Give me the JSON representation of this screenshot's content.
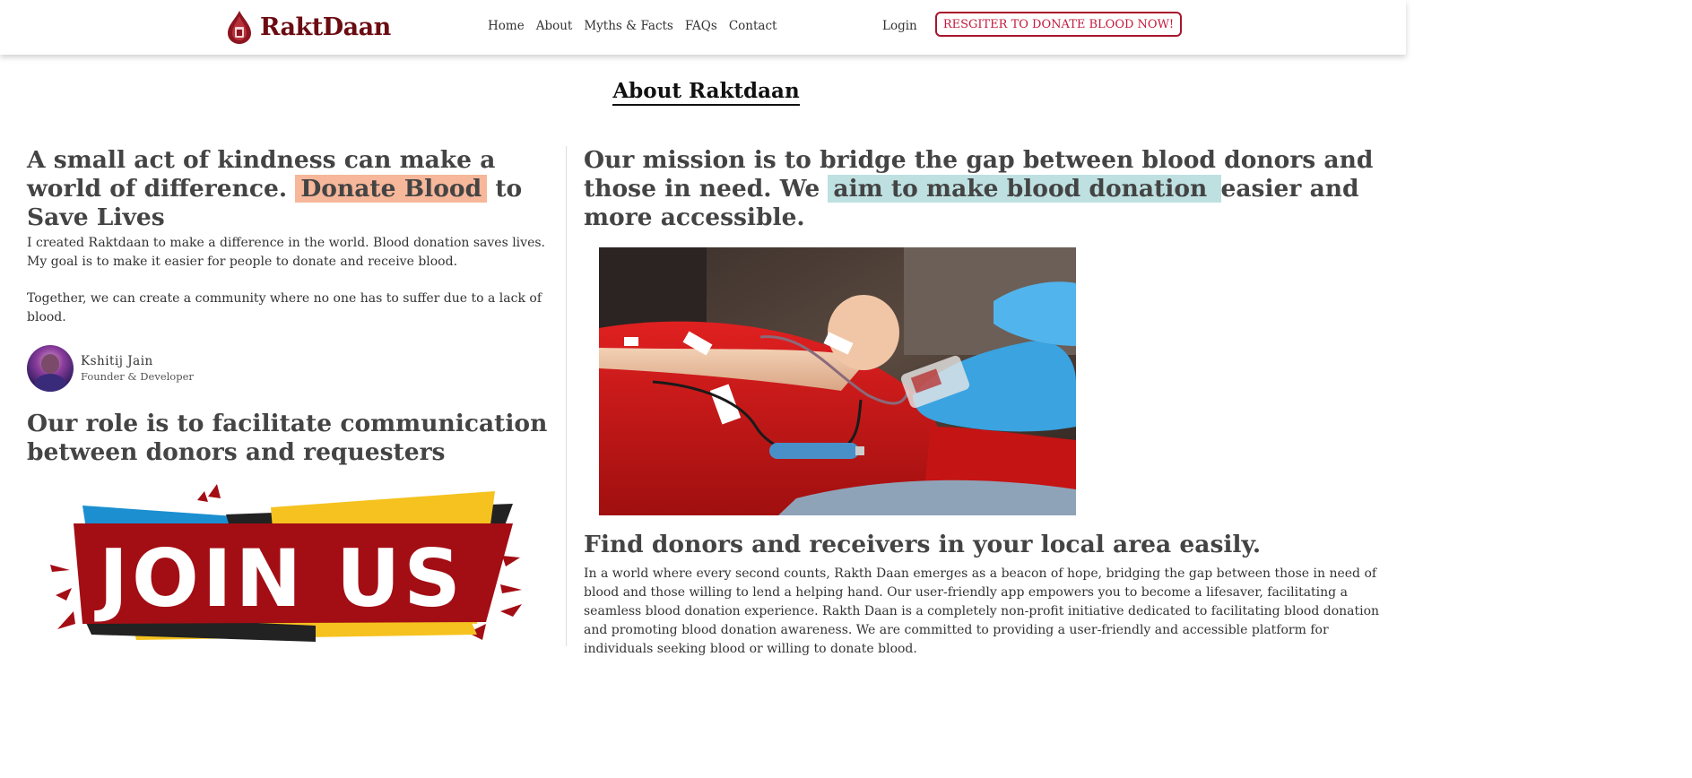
{
  "brand": {
    "name": "RaktDaan"
  },
  "nav": {
    "items": [
      "Home",
      "About",
      "Myths & Facts",
      "FAQs",
      "Contact"
    ],
    "login": "Login",
    "register": "RESGITER TO DONATE BLOOD NOW!"
  },
  "page": {
    "title": "About Raktdaan"
  },
  "left": {
    "heading_part1": "A small act of kindness can make a world of difference. ",
    "heading_highlight": "Donate Blood",
    "heading_part2": " to Save Lives",
    "para1": "I created Raktdaan to make a difference in the world. Blood donation saves lives. My goal is to make it easier for people to donate and receive blood.",
    "para2": "Together, we can create a community where no one has to suffer due to a lack of blood.",
    "founder_name": "Kshitij Jain",
    "founder_role": "Founder & Developer",
    "role_heading": "Our role is to facilitate communication between donors and requesters",
    "banner_text": "JOIN US"
  },
  "right": {
    "mission_part1": "Our mission is to bridge the gap between blood donors and those in need. We ",
    "mission_highlight": "aim to make blood donation ",
    "mission_part2": "easier and more accessible.",
    "find_heading": "Find donors and receivers in your local area easily.",
    "find_para": "In a world where every second counts, Rakth Daan emerges as a beacon of hope, bridging the gap between those in need of blood and those willing to lend a helping hand. Our user-friendly app empowers you to become a lifesaver, facilitating a seamless blood donation experience. Rakth Daan is a completely non-profit initiative dedicated to facilitating blood donation and promoting blood donation awareness. We are committed to providing a user-friendly and accessible platform for individuals seeking blood or willing to donate blood."
  },
  "colors": {
    "brand": "#6b0b12",
    "register_border": "#a8162c",
    "highlight_orange": "#f6b79a",
    "highlight_blue": "#bfe0e1"
  }
}
